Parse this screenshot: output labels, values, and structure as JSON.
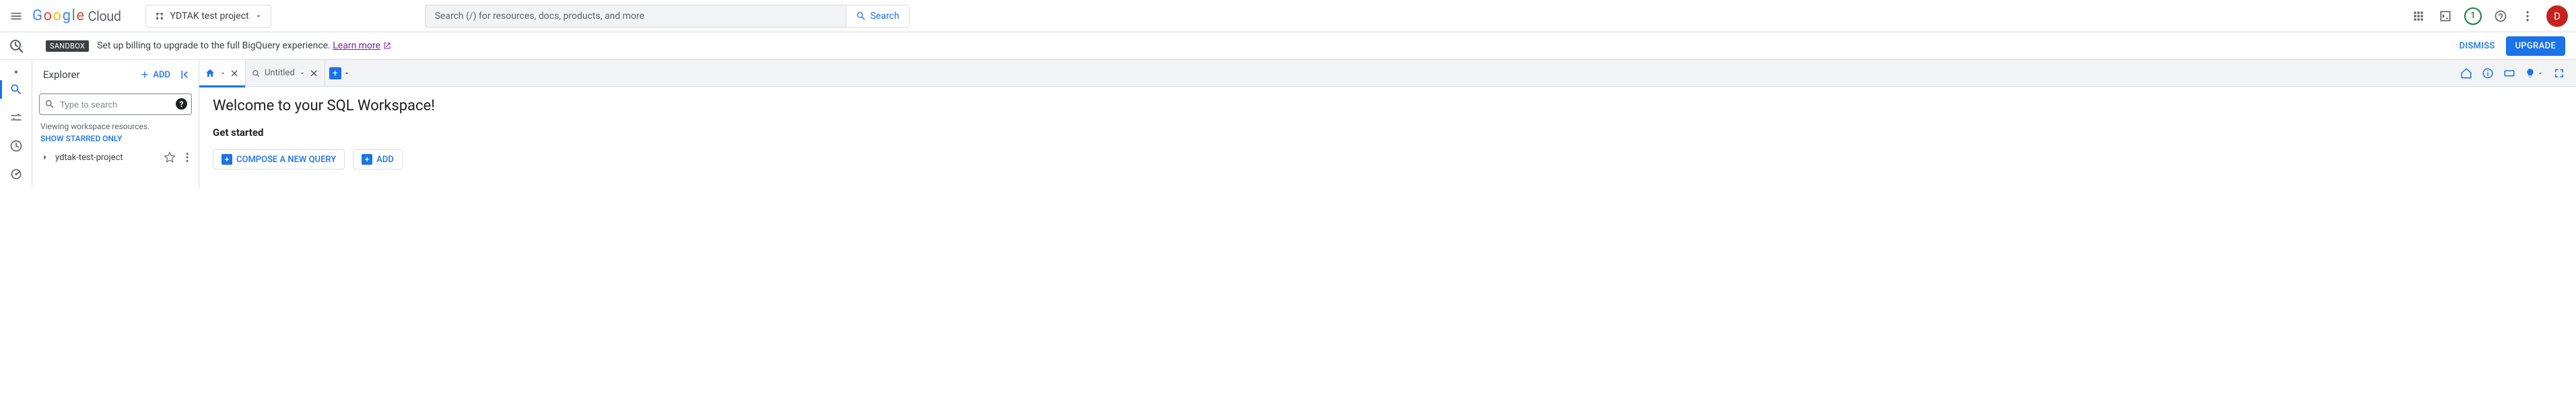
{
  "header": {
    "logo_letters": [
      "G",
      "o",
      "o",
      "g",
      "l",
      "e"
    ],
    "logo_suffix": "Cloud",
    "project_name": "YDTAK test project",
    "search_placeholder": "Search (/) for resources, docs, products, and more",
    "search_button": "Search",
    "notification_count": "1",
    "avatar_initial": "D"
  },
  "sandbox": {
    "badge": "SANDBOX",
    "text": "Set up billing to upgrade to the full BigQuery experience.",
    "learn": "Learn more",
    "dismiss": "DISMISS",
    "upgrade": "UPGRADE"
  },
  "explorer": {
    "title": "Explorer",
    "add": "ADD",
    "search_placeholder": "Type to search",
    "viewing": "Viewing workspace resources.",
    "show_starred": "SHOW STARRED ONLY",
    "project": "ydtak-test-project"
  },
  "tabs": {
    "untitled": "Untitled"
  },
  "workspace": {
    "welcome": "Welcome to your SQL Workspace!",
    "get_started": "Get started",
    "compose": "COMPOSE A NEW QUERY",
    "add": "ADD"
  }
}
